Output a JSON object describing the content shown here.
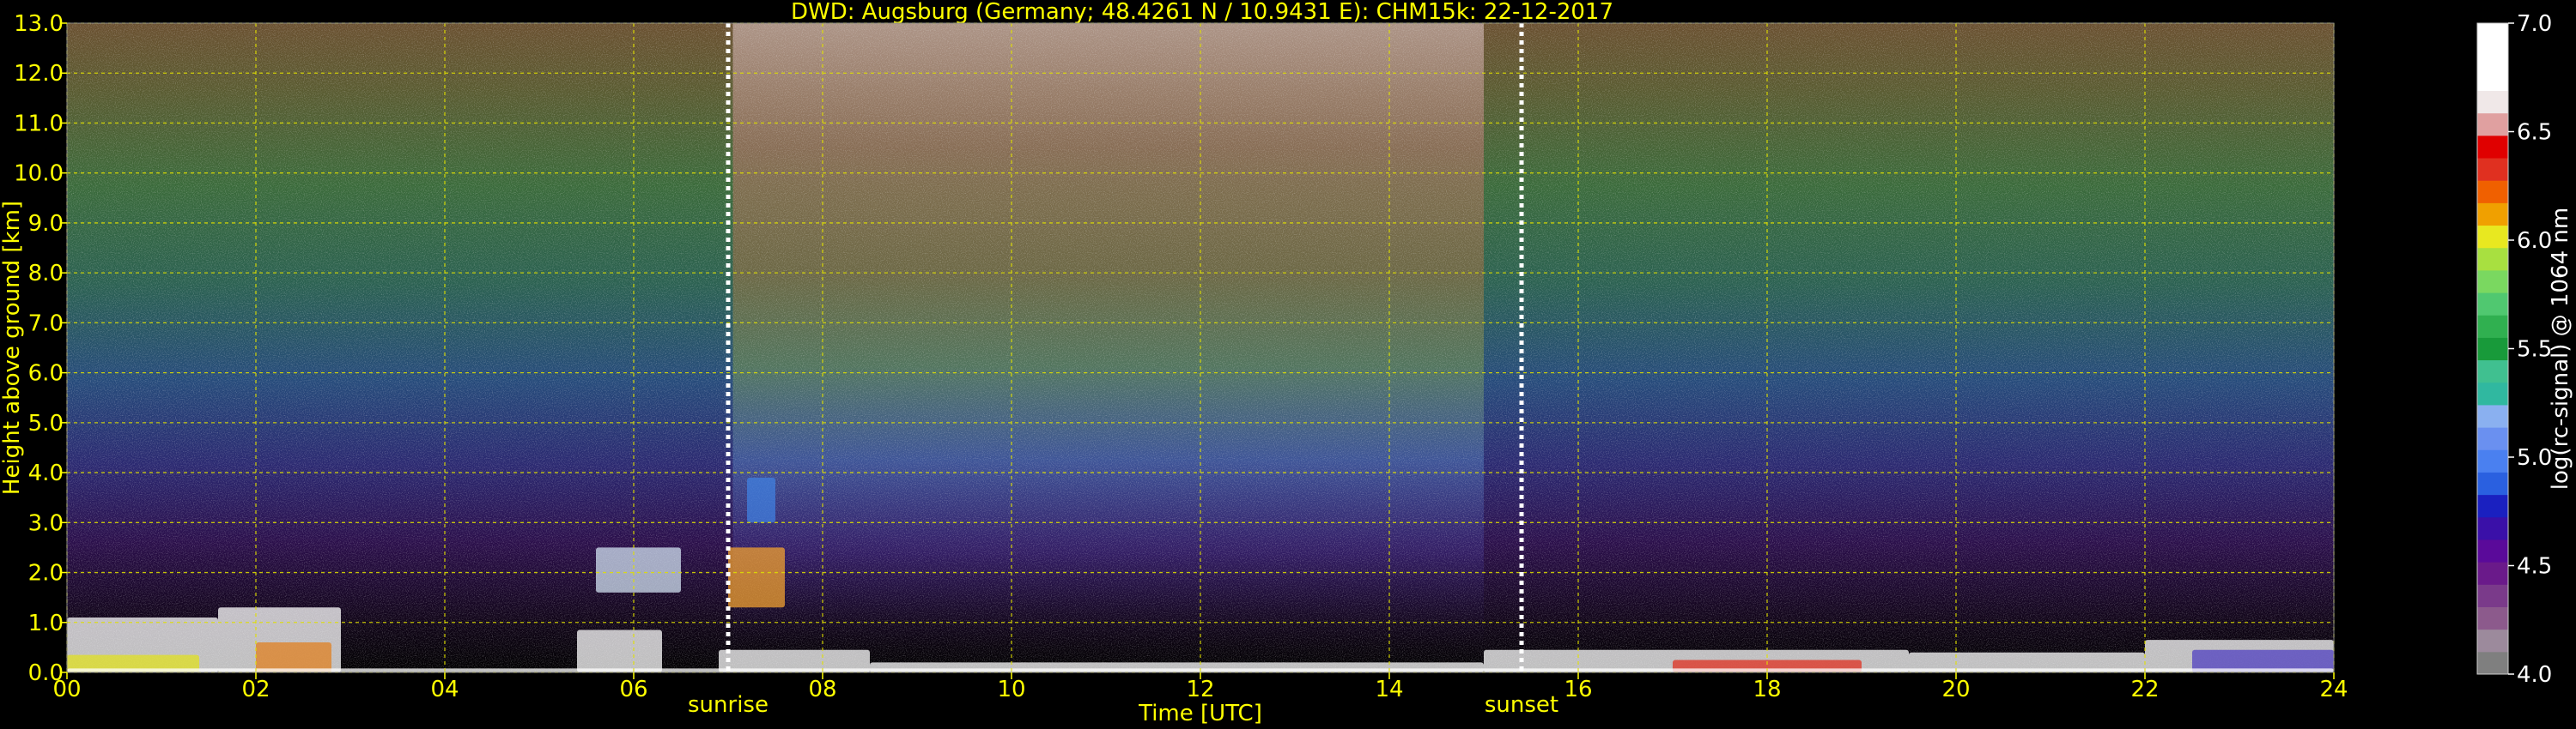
{
  "chart_data": {
    "type": "heatmap",
    "title": "DWD: Augsburg (Germany; 48.4261 N / 10.9431 E):    CHM15k: 22-12-2017",
    "xlabel": "Time [UTC]",
    "ylabel": "Height above ground [km]",
    "xlim": [
      0,
      24
    ],
    "ylim": [
      0,
      13
    ],
    "x_ticks": [
      "00",
      "02",
      "04",
      "06",
      "08",
      "10",
      "12",
      "14",
      "16",
      "18",
      "20",
      "22",
      "24"
    ],
    "y_ticks": [
      "0.0",
      "1.0",
      "2.0",
      "3.0",
      "4.0",
      "5.0",
      "6.0",
      "7.0",
      "8.0",
      "9.0",
      "10.0",
      "11.0",
      "12.0",
      "13.0"
    ],
    "grid": true,
    "events": [
      {
        "label": "sunrise",
        "x": 7.0
      },
      {
        "label": "sunset",
        "x": 15.4
      }
    ],
    "colorbar": {
      "label": "log(rc-signal) @ 1064 nm",
      "range": [
        4.0,
        7.0
      ],
      "ticks": [
        "4.0",
        "4.5",
        "5.0",
        "5.5",
        "6.0",
        "6.5",
        "7.0"
      ],
      "colors": [
        "#7f7f7f",
        "#9c8a9c",
        "#8c5a8c",
        "#7a3a8a",
        "#6a1a8a",
        "#5a0a9a",
        "#3a10a8",
        "#1a20c0",
        "#2a60e0",
        "#4a80f0",
        "#6a90f0",
        "#8ab0f0",
        "#30b8a0",
        "#40c090",
        "#189a3a",
        "#30b050",
        "#50c870",
        "#7ad860",
        "#a8e040",
        "#e8e820",
        "#f0a000",
        "#f06000",
        "#e03020",
        "#e00000",
        "#e0a0a0",
        "#f0e8e8",
        "#ffffff",
        "#ffffff",
        "#ffffff"
      ]
    },
    "colors": {
      "text": "#ffff00",
      "grid": "#e0e000",
      "background": "#000000",
      "colorbar_text": "#ffffff"
    }
  }
}
